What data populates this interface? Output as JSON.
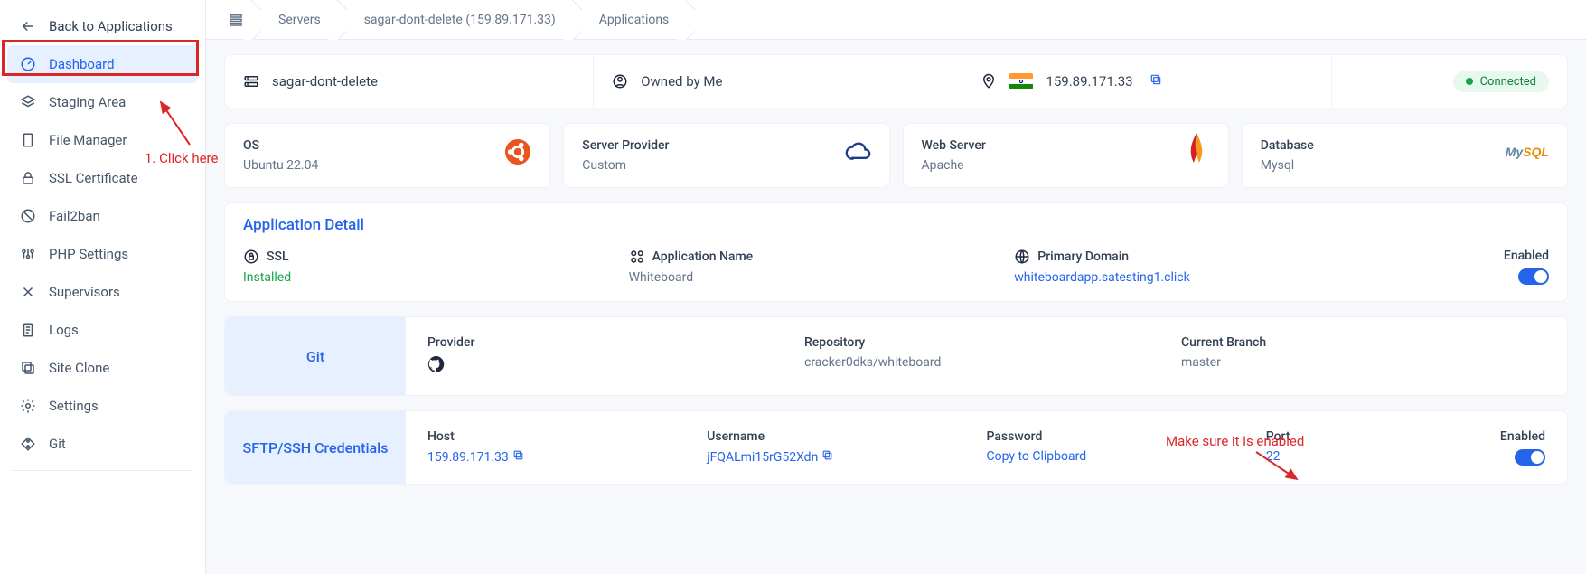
{
  "sidebar": {
    "back": "Back to Applications",
    "items": [
      {
        "label": "Dashboard",
        "icon": "gauge-icon",
        "active": true
      },
      {
        "label": "Staging Area",
        "icon": "layers-icon"
      },
      {
        "label": "File Manager",
        "icon": "file-icon"
      },
      {
        "label": "SSL Certificate",
        "icon": "lock-icon"
      },
      {
        "label": "Fail2ban",
        "icon": "ban-icon"
      },
      {
        "label": "PHP Settings",
        "icon": "sliders-icon"
      },
      {
        "label": "Supervisors",
        "icon": "tools-icon"
      },
      {
        "label": "Logs",
        "icon": "document-icon"
      },
      {
        "label": "Site Clone",
        "icon": "copy-icon"
      },
      {
        "label": "Settings",
        "icon": "gear-icon"
      },
      {
        "label": "Git",
        "icon": "git-icon"
      }
    ]
  },
  "breadcrumb": {
    "items": [
      "Servers",
      "sagar-dont-delete (159.89.171.33)",
      "Applications"
    ]
  },
  "serverBar": {
    "name": "sagar-dont-delete",
    "owner": "Owned by Me",
    "ip": "159.89.171.33",
    "status": "Connected"
  },
  "infoCards": {
    "os": {
      "label": "OS",
      "value": "Ubuntu 22.04"
    },
    "provider": {
      "label": "Server Provider",
      "value": "Custom"
    },
    "webserver": {
      "label": "Web Server",
      "value": "Apache"
    },
    "database": {
      "label": "Database",
      "value": "Mysql"
    }
  },
  "appDetail": {
    "title": "Application Detail",
    "ssl": {
      "label": "SSL",
      "value": "Installed"
    },
    "name": {
      "label": "Application Name",
      "value": "Whiteboard"
    },
    "domain": {
      "label": "Primary Domain",
      "value": "whiteboardapp.satesting1.click"
    },
    "enabled": {
      "label": "Enabled"
    }
  },
  "git": {
    "title": "Git",
    "provider": {
      "label": "Provider"
    },
    "repo": {
      "label": "Repository",
      "value": "cracker0dks/whiteboard"
    },
    "branch": {
      "label": "Current Branch",
      "value": "master"
    }
  },
  "sftp": {
    "title": "SFTP/SSH Credentials",
    "host": {
      "label": "Host",
      "value": "159.89.171.33"
    },
    "user": {
      "label": "Username",
      "value": "jFQALmi15rG52Xdn"
    },
    "pass": {
      "label": "Password",
      "value": "Copy to Clipboard"
    },
    "port": {
      "label": "Port",
      "value": "22"
    },
    "enabled": {
      "label": "Enabled"
    }
  },
  "annotations": {
    "clickHere": "1. Click here",
    "enabledNote": "Make sure it is enabled"
  }
}
